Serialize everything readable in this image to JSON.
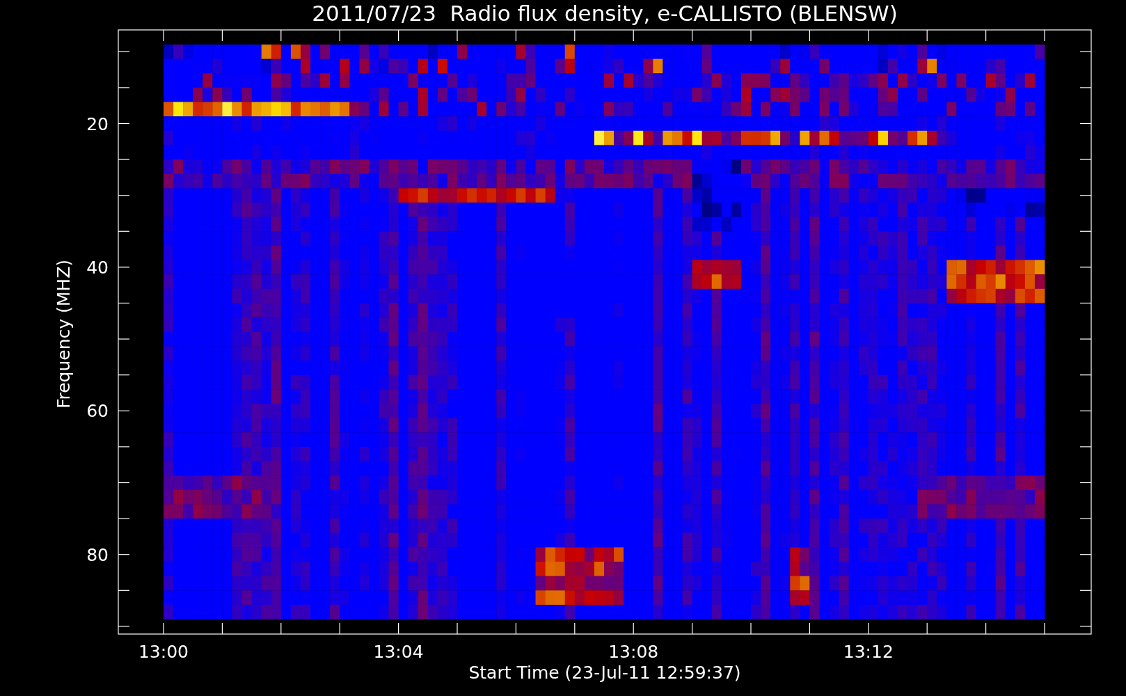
{
  "title": "2011/07/23  Radio flux density, e-CALLISTO (BLENSW)",
  "plot": {
    "ylabel": "Frequency (MHZ)",
    "xlabel": "Start Time (23-Jul-11 12:59:37)",
    "yticks": [
      "20",
      "40",
      "60",
      "80"
    ],
    "xticks": [
      "13:00",
      "13:04",
      "13:08",
      "13:12"
    ]
  }
}
